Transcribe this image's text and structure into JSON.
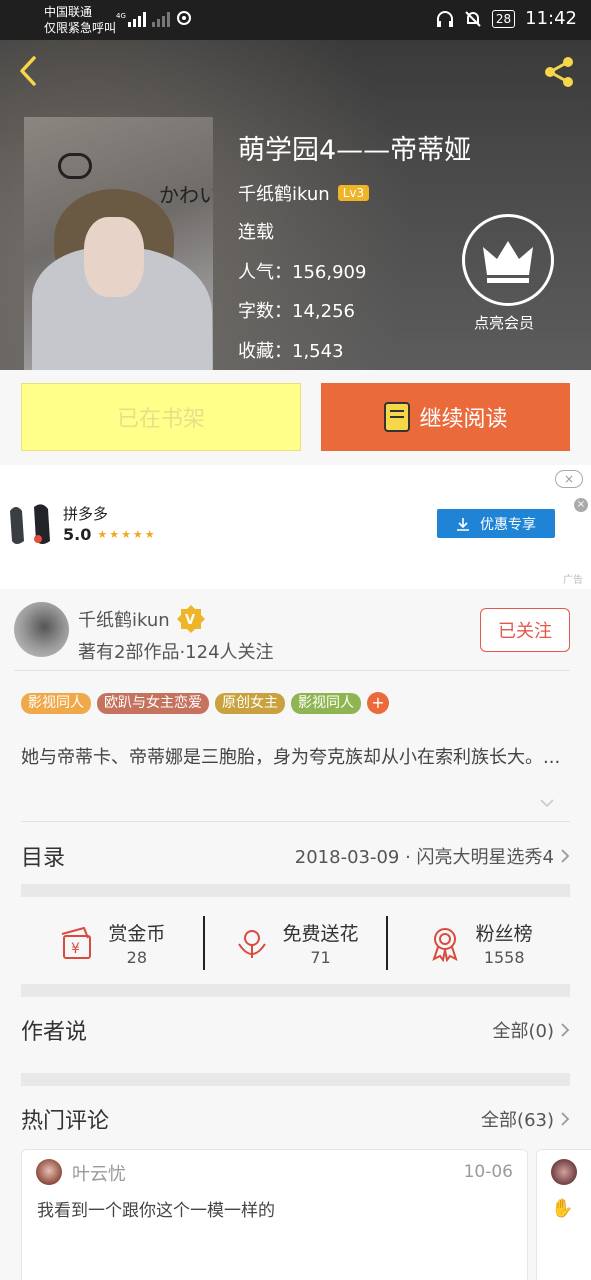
{
  "status_bar": {
    "carrier_line1": "中国联通",
    "carrier_line2": "仅限紧急呼叫",
    "signal_label": "4G",
    "battery": "28",
    "time": "11:42"
  },
  "book": {
    "title": "萌学园4——帝蒂娅",
    "author": "千纸鹤ikun",
    "author_level": "Lv3",
    "status": "连载",
    "popularity_label": "人气：",
    "popularity": "156,909",
    "word_count_label": "字数：",
    "word_count": "14,256",
    "favorites_label": "收藏：",
    "favorites": "1,543",
    "cover_text": "かわい",
    "vip_label": "点亮会员"
  },
  "actions": {
    "shelf_label": "已在书架",
    "read_label": "继续阅读"
  },
  "ad": {
    "close": "×",
    "app_name": "拼多多",
    "rating": "5.0",
    "stars": "★★★★★",
    "button_label": "优惠专享",
    "tag": "广告"
  },
  "author_card": {
    "name": "千纸鹤ikun",
    "stats": "著有2部作品·124人关注",
    "follow_label": "已关注",
    "tags": [
      {
        "label": "影视同人",
        "color": "#efa94a"
      },
      {
        "label": "欧趴与女主恋爱",
        "color": "#c5735e"
      },
      {
        "label": "原创女主",
        "color": "#c9a13f"
      },
      {
        "label": "影视同人",
        "color": "#8fb552"
      }
    ],
    "tag_more": "+",
    "description": "她与帝蒂卡、帝蒂娜是三胞胎，身为夸克族却从小在索利族长大。..."
  },
  "catalog": {
    "label": "目录",
    "latest": "2018-03-09 · 闪亮大明星选秀4"
  },
  "rewards": [
    {
      "label": "赏金币",
      "count": "28",
      "icon": "coin-icon"
    },
    {
      "label": "免费送花",
      "count": "71",
      "icon": "flower-icon"
    },
    {
      "label": "粉丝榜",
      "count": "1558",
      "icon": "medal-icon"
    }
  ],
  "author_says": {
    "label": "作者说",
    "all": "全部(0)"
  },
  "hot_comments": {
    "label": "热门评论",
    "all": "全部(63)",
    "items": [
      {
        "user": "叶云忧",
        "date": "10-06",
        "text": "我看到一个跟你这个一模一样的"
      }
    ]
  },
  "colors": {
    "accent": "#ea6a3b",
    "shelf_bg": "#ffff8a",
    "follow": "#e4574c",
    "ad_button": "#1f84d6",
    "level_badge": "#f0b429"
  }
}
